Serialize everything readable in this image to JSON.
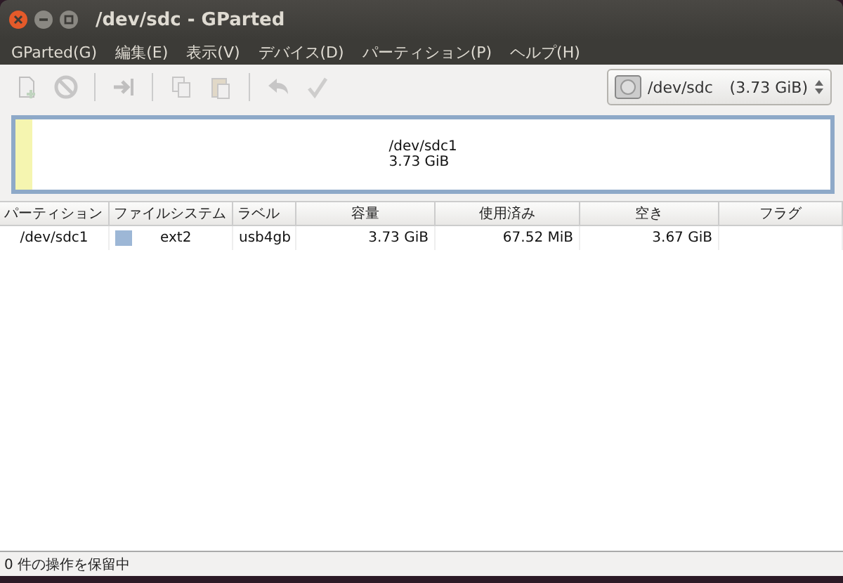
{
  "window": {
    "title": "/dev/sdc - GParted"
  },
  "menu": [
    "GParted(G)",
    "編集(E)",
    "表示(V)",
    "デバイス(D)",
    "パーティション(P)",
    "ヘルプ(H)"
  ],
  "toolbar": [
    {
      "kind": "new",
      "disabled": true
    },
    {
      "kind": "delete",
      "disabled": true
    },
    {
      "kind": "sep"
    },
    {
      "kind": "resize",
      "disabled": true
    },
    {
      "kind": "sep"
    },
    {
      "kind": "copy",
      "disabled": true
    },
    {
      "kind": "paste",
      "disabled": true
    },
    {
      "kind": "sep"
    },
    {
      "kind": "undo",
      "disabled": true
    },
    {
      "kind": "apply",
      "disabled": true
    }
  ],
  "device": {
    "name": "/dev/sdc",
    "size": "(3.73 GiB)"
  },
  "graph": {
    "name": "/dev/sdc1",
    "size": "3.73 GiB",
    "level": 0.02
  },
  "table": {
    "columns": [
      "パーティション",
      "ファイルシステム",
      "ラベル",
      "容量",
      "使用済み",
      "空き",
      "フラグ"
    ],
    "rows": [
      {
        "partition": "/dev/sdc1",
        "filesystem": "ext2",
        "color": "#9db7d6",
        "label": "usb4gb",
        "size": "3.73 GiB",
        "used": "67.52 MiB",
        "free": "3.67 GiB",
        "selected": false
      }
    ]
  },
  "status_bar": "0 件の操作を保留中"
}
